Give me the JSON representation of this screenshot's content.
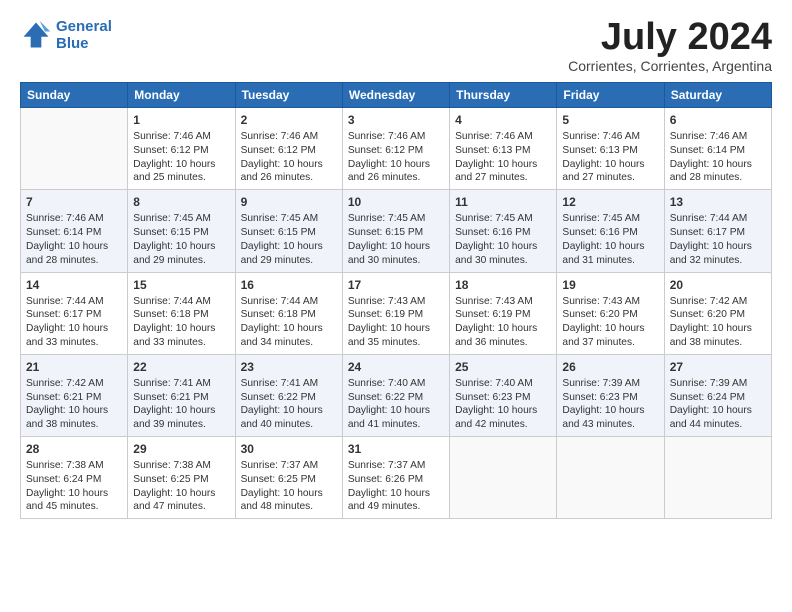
{
  "logo": {
    "line1": "General",
    "line2": "Blue"
  },
  "title": "July 2024",
  "location": "Corrientes, Corrientes, Argentina",
  "days_of_week": [
    "Sunday",
    "Monday",
    "Tuesday",
    "Wednesday",
    "Thursday",
    "Friday",
    "Saturday"
  ],
  "weeks": [
    [
      {
        "day": "",
        "sunrise": "",
        "sunset": "",
        "daylight": ""
      },
      {
        "day": "1",
        "sunrise": "Sunrise: 7:46 AM",
        "sunset": "Sunset: 6:12 PM",
        "daylight": "Daylight: 10 hours and 25 minutes."
      },
      {
        "day": "2",
        "sunrise": "Sunrise: 7:46 AM",
        "sunset": "Sunset: 6:12 PM",
        "daylight": "Daylight: 10 hours and 26 minutes."
      },
      {
        "day": "3",
        "sunrise": "Sunrise: 7:46 AM",
        "sunset": "Sunset: 6:12 PM",
        "daylight": "Daylight: 10 hours and 26 minutes."
      },
      {
        "day": "4",
        "sunrise": "Sunrise: 7:46 AM",
        "sunset": "Sunset: 6:13 PM",
        "daylight": "Daylight: 10 hours and 27 minutes."
      },
      {
        "day": "5",
        "sunrise": "Sunrise: 7:46 AM",
        "sunset": "Sunset: 6:13 PM",
        "daylight": "Daylight: 10 hours and 27 minutes."
      },
      {
        "day": "6",
        "sunrise": "Sunrise: 7:46 AM",
        "sunset": "Sunset: 6:14 PM",
        "daylight": "Daylight: 10 hours and 28 minutes."
      }
    ],
    [
      {
        "day": "7",
        "sunrise": "Sunrise: 7:46 AM",
        "sunset": "Sunset: 6:14 PM",
        "daylight": "Daylight: 10 hours and 28 minutes."
      },
      {
        "day": "8",
        "sunrise": "Sunrise: 7:45 AM",
        "sunset": "Sunset: 6:15 PM",
        "daylight": "Daylight: 10 hours and 29 minutes."
      },
      {
        "day": "9",
        "sunrise": "Sunrise: 7:45 AM",
        "sunset": "Sunset: 6:15 PM",
        "daylight": "Daylight: 10 hours and 29 minutes."
      },
      {
        "day": "10",
        "sunrise": "Sunrise: 7:45 AM",
        "sunset": "Sunset: 6:15 PM",
        "daylight": "Daylight: 10 hours and 30 minutes."
      },
      {
        "day": "11",
        "sunrise": "Sunrise: 7:45 AM",
        "sunset": "Sunset: 6:16 PM",
        "daylight": "Daylight: 10 hours and 30 minutes."
      },
      {
        "day": "12",
        "sunrise": "Sunrise: 7:45 AM",
        "sunset": "Sunset: 6:16 PM",
        "daylight": "Daylight: 10 hours and 31 minutes."
      },
      {
        "day": "13",
        "sunrise": "Sunrise: 7:44 AM",
        "sunset": "Sunset: 6:17 PM",
        "daylight": "Daylight: 10 hours and 32 minutes."
      }
    ],
    [
      {
        "day": "14",
        "sunrise": "Sunrise: 7:44 AM",
        "sunset": "Sunset: 6:17 PM",
        "daylight": "Daylight: 10 hours and 33 minutes."
      },
      {
        "day": "15",
        "sunrise": "Sunrise: 7:44 AM",
        "sunset": "Sunset: 6:18 PM",
        "daylight": "Daylight: 10 hours and 33 minutes."
      },
      {
        "day": "16",
        "sunrise": "Sunrise: 7:44 AM",
        "sunset": "Sunset: 6:18 PM",
        "daylight": "Daylight: 10 hours and 34 minutes."
      },
      {
        "day": "17",
        "sunrise": "Sunrise: 7:43 AM",
        "sunset": "Sunset: 6:19 PM",
        "daylight": "Daylight: 10 hours and 35 minutes."
      },
      {
        "day": "18",
        "sunrise": "Sunrise: 7:43 AM",
        "sunset": "Sunset: 6:19 PM",
        "daylight": "Daylight: 10 hours and 36 minutes."
      },
      {
        "day": "19",
        "sunrise": "Sunrise: 7:43 AM",
        "sunset": "Sunset: 6:20 PM",
        "daylight": "Daylight: 10 hours and 37 minutes."
      },
      {
        "day": "20",
        "sunrise": "Sunrise: 7:42 AM",
        "sunset": "Sunset: 6:20 PM",
        "daylight": "Daylight: 10 hours and 38 minutes."
      }
    ],
    [
      {
        "day": "21",
        "sunrise": "Sunrise: 7:42 AM",
        "sunset": "Sunset: 6:21 PM",
        "daylight": "Daylight: 10 hours and 38 minutes."
      },
      {
        "day": "22",
        "sunrise": "Sunrise: 7:41 AM",
        "sunset": "Sunset: 6:21 PM",
        "daylight": "Daylight: 10 hours and 39 minutes."
      },
      {
        "day": "23",
        "sunrise": "Sunrise: 7:41 AM",
        "sunset": "Sunset: 6:22 PM",
        "daylight": "Daylight: 10 hours and 40 minutes."
      },
      {
        "day": "24",
        "sunrise": "Sunrise: 7:40 AM",
        "sunset": "Sunset: 6:22 PM",
        "daylight": "Daylight: 10 hours and 41 minutes."
      },
      {
        "day": "25",
        "sunrise": "Sunrise: 7:40 AM",
        "sunset": "Sunset: 6:23 PM",
        "daylight": "Daylight: 10 hours and 42 minutes."
      },
      {
        "day": "26",
        "sunrise": "Sunrise: 7:39 AM",
        "sunset": "Sunset: 6:23 PM",
        "daylight": "Daylight: 10 hours and 43 minutes."
      },
      {
        "day": "27",
        "sunrise": "Sunrise: 7:39 AM",
        "sunset": "Sunset: 6:24 PM",
        "daylight": "Daylight: 10 hours and 44 minutes."
      }
    ],
    [
      {
        "day": "28",
        "sunrise": "Sunrise: 7:38 AM",
        "sunset": "Sunset: 6:24 PM",
        "daylight": "Daylight: 10 hours and 45 minutes."
      },
      {
        "day": "29",
        "sunrise": "Sunrise: 7:38 AM",
        "sunset": "Sunset: 6:25 PM",
        "daylight": "Daylight: 10 hours and 47 minutes."
      },
      {
        "day": "30",
        "sunrise": "Sunrise: 7:37 AM",
        "sunset": "Sunset: 6:25 PM",
        "daylight": "Daylight: 10 hours and 48 minutes."
      },
      {
        "day": "31",
        "sunrise": "Sunrise: 7:37 AM",
        "sunset": "Sunset: 6:26 PM",
        "daylight": "Daylight: 10 hours and 49 minutes."
      },
      {
        "day": "",
        "sunrise": "",
        "sunset": "",
        "daylight": ""
      },
      {
        "day": "",
        "sunrise": "",
        "sunset": "",
        "daylight": ""
      },
      {
        "day": "",
        "sunrise": "",
        "sunset": "",
        "daylight": ""
      }
    ]
  ]
}
